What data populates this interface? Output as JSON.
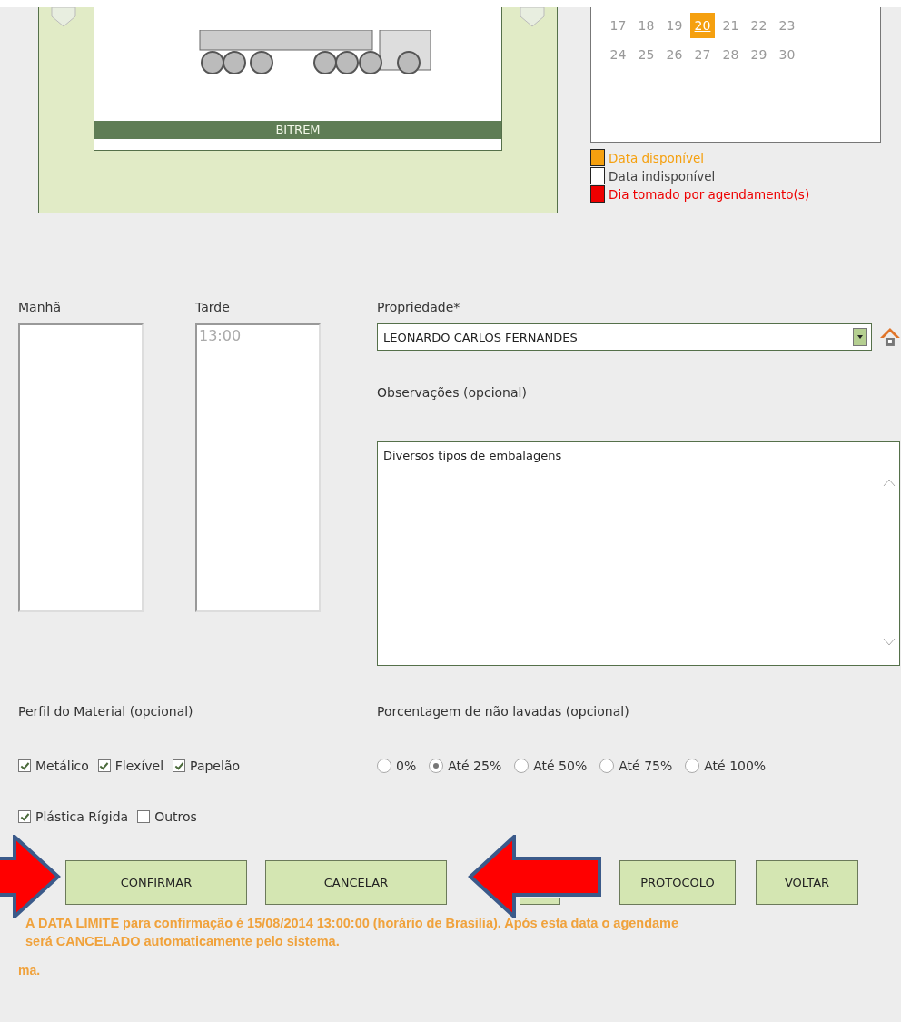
{
  "vehicle": {
    "name": "BITREM"
  },
  "calendar": {
    "weeks": [
      {
        "days": [
          {
            "label": "17",
            "selected": false
          },
          {
            "label": "18",
            "selected": false
          },
          {
            "label": "19",
            "selected": false
          },
          {
            "label": "20",
            "selected": true
          },
          {
            "label": "21",
            "selected": false
          },
          {
            "label": "22",
            "selected": false
          },
          {
            "label": "23",
            "selected": false
          }
        ]
      },
      {
        "days": [
          {
            "label": "24",
            "selected": false
          },
          {
            "label": "25",
            "selected": false
          },
          {
            "label": "26",
            "selected": false
          },
          {
            "label": "27",
            "selected": false
          },
          {
            "label": "28",
            "selected": false
          },
          {
            "label": "29",
            "selected": false
          },
          {
            "label": "30",
            "selected": false
          }
        ]
      }
    ]
  },
  "legend": [
    {
      "label": "Data disponível",
      "color": "#f5a00f"
    },
    {
      "label": "Data indisponível",
      "color": "#ffffff"
    },
    {
      "label": "Dia tomado por agendamento(s)",
      "color": "#ee0000"
    }
  ],
  "morning": {
    "label": "Manhã"
  },
  "afternoon": {
    "label": "Tarde",
    "items": [
      "13:00"
    ]
  },
  "property": {
    "label": "Propriedade*",
    "value": "LEONARDO CARLOS FERNANDES"
  },
  "notes": {
    "label": "Observações (opcional)",
    "value": "Diversos tipos de embalagens"
  },
  "material": {
    "label": "Perfil do Material (opcional)",
    "rows": [
      [
        {
          "label": "Metálico",
          "checked": true
        },
        {
          "label": "Flexível",
          "checked": true
        },
        {
          "label": "Papelão",
          "checked": true
        }
      ],
      [
        {
          "label": "Plástica Rígida",
          "checked": true
        },
        {
          "label": "Outros",
          "checked": false
        }
      ]
    ]
  },
  "unwashed": {
    "label": "Porcentagem de não lavadas (opcional)",
    "options": [
      {
        "label": "0%",
        "selected": false
      },
      {
        "label": "Até 25%",
        "selected": true
      },
      {
        "label": "Até 50%",
        "selected": false
      },
      {
        "label": "Até 75%",
        "selected": false
      },
      {
        "label": "Até 100%",
        "selected": false
      }
    ]
  },
  "buttons": [
    {
      "kind": "labeled",
      "label": "CONFIRMAR"
    },
    {
      "kind": "labeled",
      "label": "CANCELAR"
    },
    {
      "kind": "covered"
    },
    {
      "kind": "labeled",
      "label": "PROTOCOLO"
    },
    {
      "kind": "labeled",
      "label": "VOLTAR"
    }
  ],
  "notice": {
    "line_1": "A DATA LIMITE para confirmação é 15/08/2014 13:00:00 (horário de Brasilia). Após esta data o agendame",
    "line_2": "será CANCELADO automaticamente pelo sistema.",
    "footer": "ma."
  }
}
